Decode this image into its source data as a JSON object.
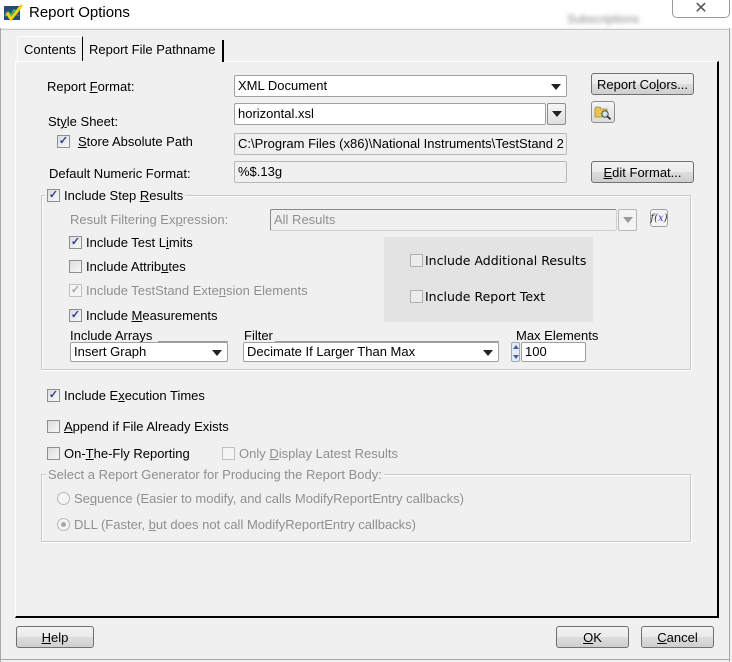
{
  "window": {
    "title": "Report Options",
    "background_title": "Subscriptions",
    "close_glyph": "✕"
  },
  "tabs": [
    {
      "label": "Contents",
      "active": true
    },
    {
      "label": "Report File Pathname",
      "active": false
    }
  ],
  "contents": {
    "report_format": {
      "label_pre": "Report ",
      "label_ul": "F",
      "label_post": "ormat:",
      "value": "XML Document"
    },
    "report_colors_button": {
      "pre": "Report Co",
      "ul": "l",
      "post": "ors..."
    },
    "style_sheet": {
      "label_pre": "St",
      "label_ul": "y",
      "label_post": "le Sheet:",
      "value": "horizontal.xsl"
    },
    "store_absolute_path": {
      "checked": true,
      "ul": "S",
      "post": "tore Absolute Path",
      "value": "C:\\Program Files (x86)\\National Instruments\\TestStand 2"
    },
    "default_numeric_format": {
      "label": "Default Numeric Format:",
      "value": "%$.13g"
    },
    "edit_format_button": {
      "ul": "E",
      "post": "dit Format..."
    },
    "include_step_results": {
      "checked": true,
      "label_pre": "Include Step ",
      "label_ul": "R",
      "label_post": "esults",
      "filtering_expression": {
        "label_pre": "Result Filtering Ex",
        "label_ul": "p",
        "label_post": "ression:",
        "value": "All Results",
        "enabled": false
      },
      "fx_button": {
        "f": "f(",
        "x": "x",
        "close": ")"
      },
      "include_test_limits": {
        "checked": true,
        "pre": "Include Test L",
        "ul": "i",
        "post": "mits"
      },
      "include_attributes": {
        "checked": false,
        "pre": "Include Attrib",
        "ul": "u",
        "post": "tes"
      },
      "include_teststand_extension": {
        "checked": true,
        "enabled": false,
        "pre": "Include TestStand Exte",
        "ul": "n",
        "post": "sion Elements"
      },
      "include_measurements": {
        "checked": true,
        "pre": "Include ",
        "ul": "M",
        "post": "easurements"
      },
      "include_additional_results": {
        "checked": false,
        "label": "Include Additional Results"
      },
      "include_report_text": {
        "checked": false,
        "label": "Include Report Text"
      },
      "include_arrays": {
        "label": "Include Arrays",
        "value": "Insert Graph"
      },
      "filter": {
        "label": "Filter",
        "value": "Decimate If Larger Than Max"
      },
      "max_elements": {
        "label": "Max Elements",
        "value": "100"
      }
    },
    "include_execution_times": {
      "checked": true,
      "pre": "Include E",
      "ul": "x",
      "post": "ecution Times"
    },
    "append_if_exists": {
      "checked": false,
      "pre": "",
      "ul": "A",
      "post": "ppend if File Already Exists"
    },
    "on_the_fly": {
      "checked": false,
      "pre": "On-",
      "ul": "T",
      "post": "he-Fly Reporting"
    },
    "only_display_latest": {
      "checked": false,
      "enabled": false,
      "pre": "Only ",
      "ul": "D",
      "post": "isplay Latest Results"
    },
    "report_generator": {
      "legend": "Select a Report Generator for Producing the Report Body:",
      "options": [
        {
          "pre": "Se",
          "ul": "q",
          "post": "uence (Easier to modify, and calls ModifyReportEntry callbacks)",
          "selected": false
        },
        {
          "pre": "DLL (Faster, ",
          "ul": "b",
          "post": "ut does not call ModifyReportEntry callbacks)",
          "selected": true
        }
      ]
    }
  },
  "footer": {
    "help": {
      "ul": "H",
      "post": "elp"
    },
    "ok": {
      "ul": "O",
      "post": "K"
    },
    "cancel": {
      "ul": "C",
      "post": "ancel"
    }
  },
  "check_glyph": "✓"
}
